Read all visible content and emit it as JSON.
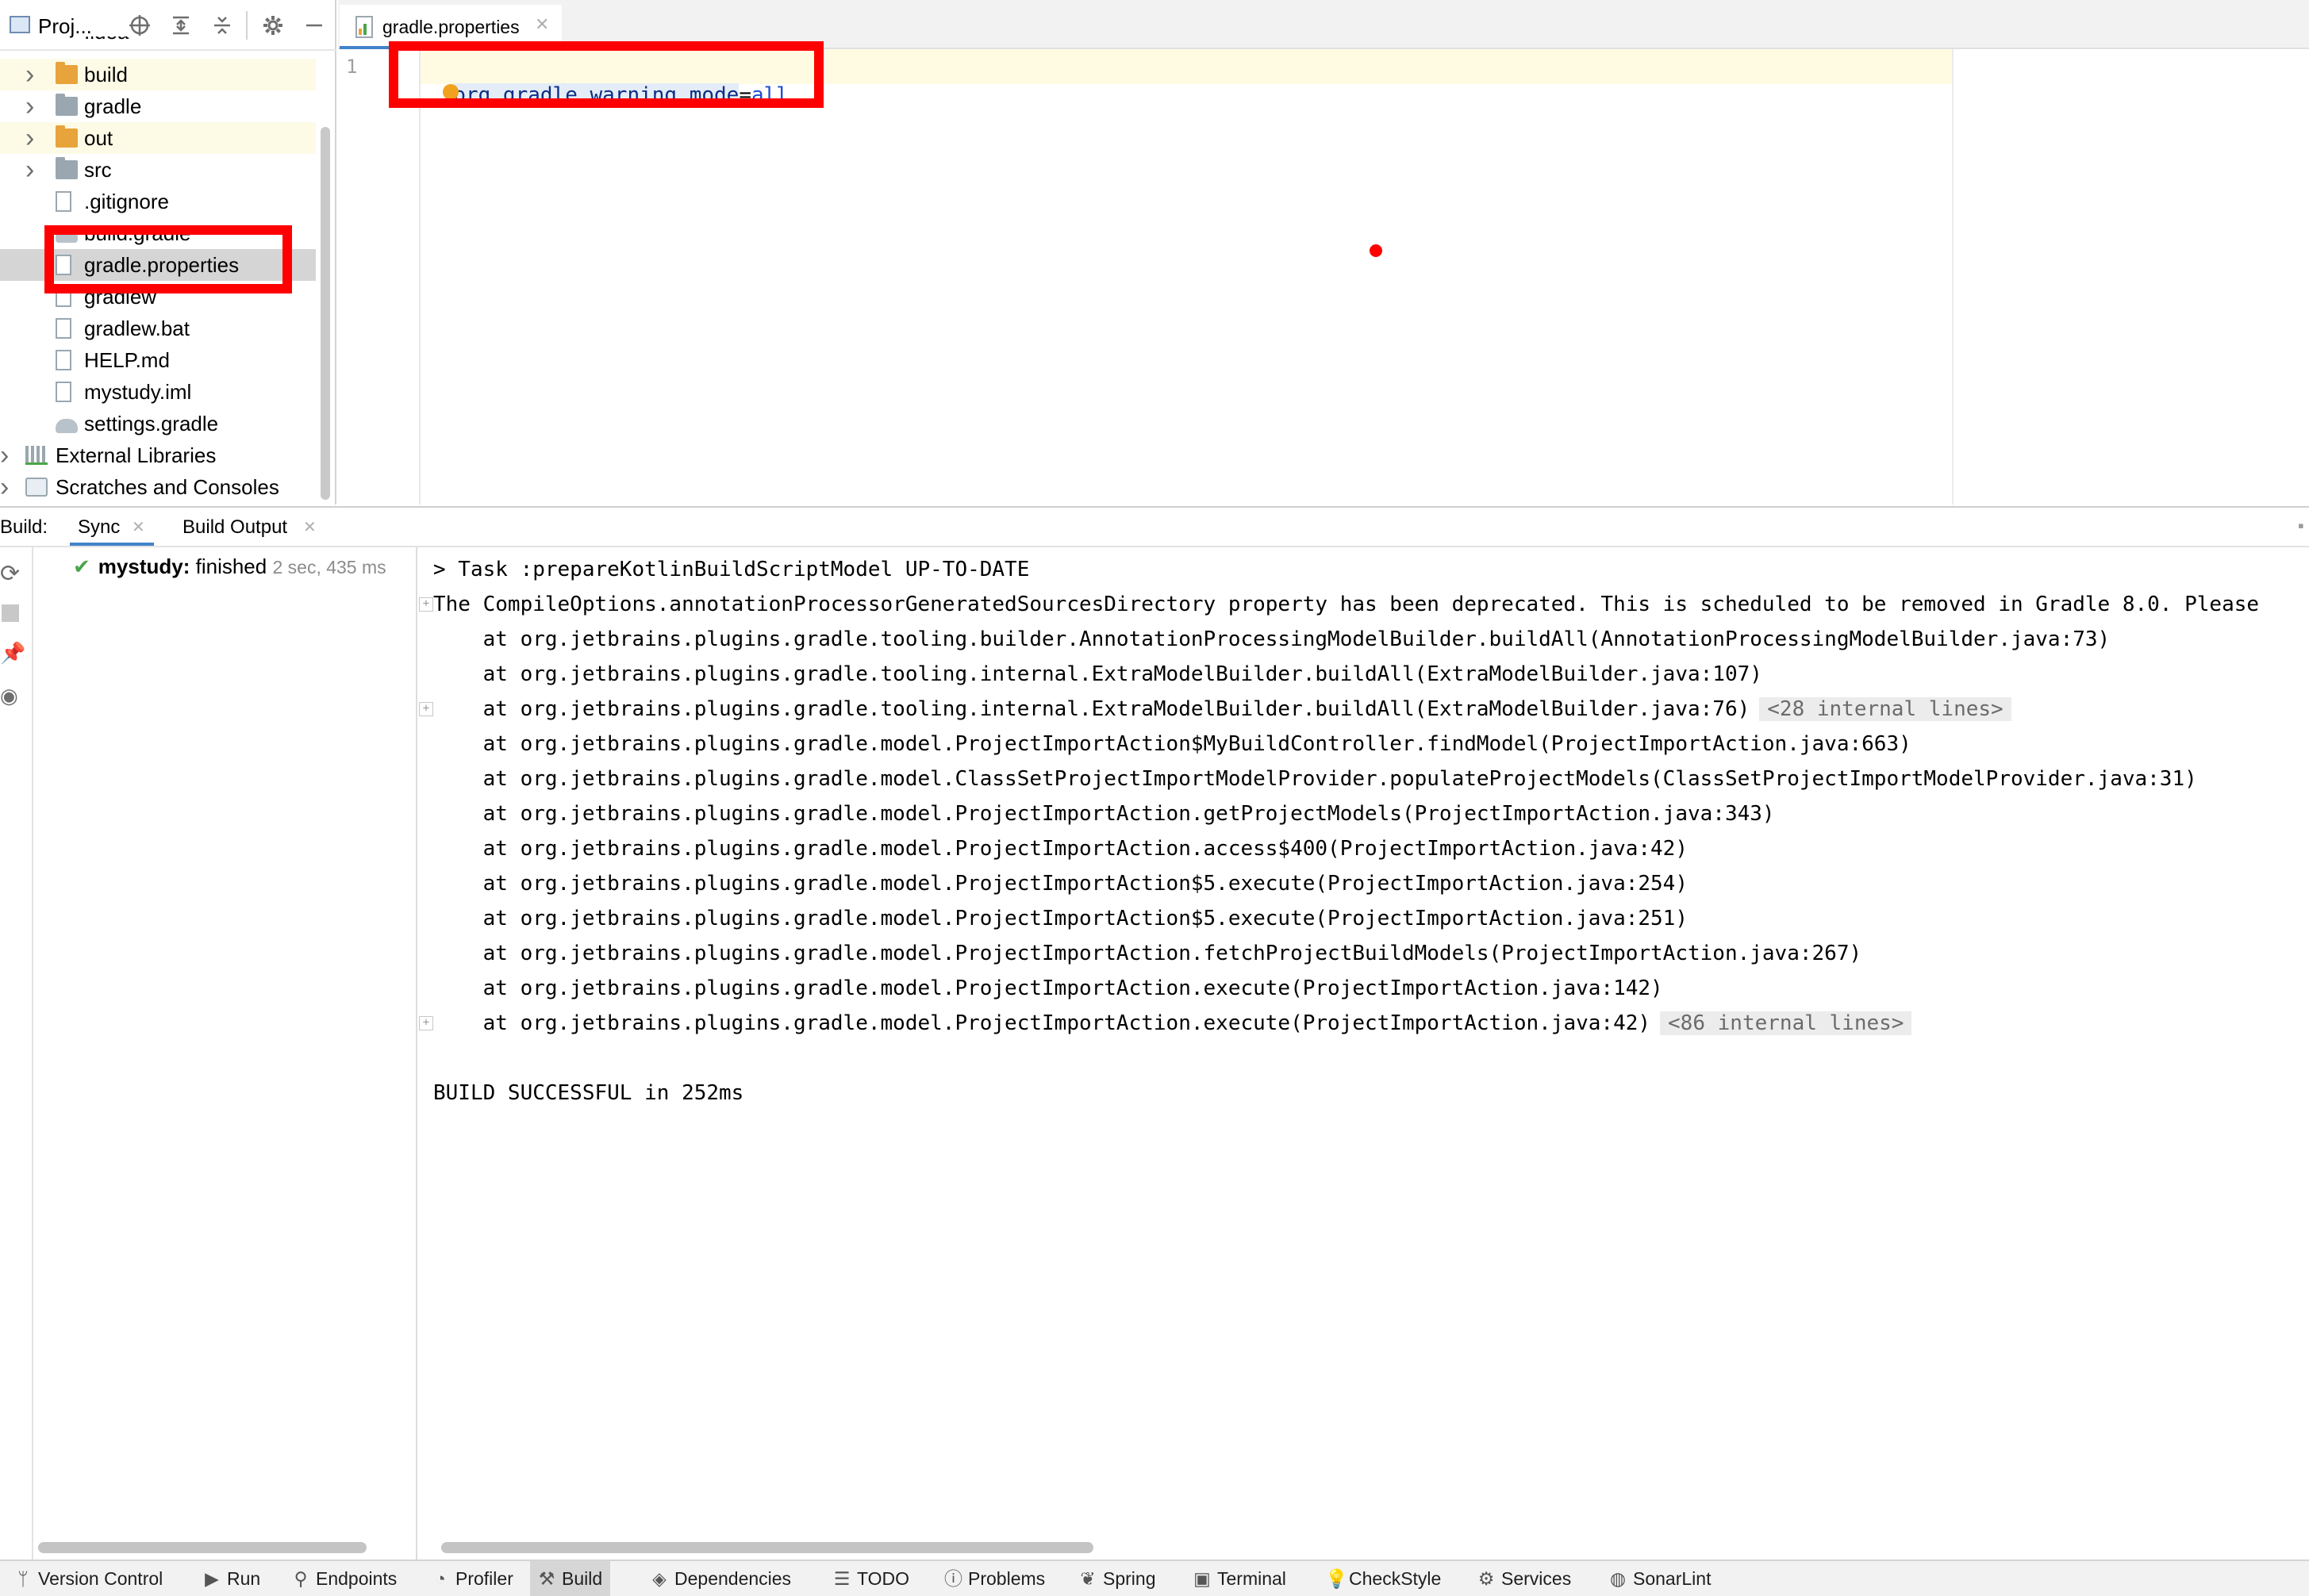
{
  "project_panel": {
    "title": "Proj...",
    "tree": [
      {
        "label": "build",
        "icon": "folder-orange-icon",
        "expandable": true,
        "highlight": true
      },
      {
        "label": "gradle",
        "icon": "folder-icon",
        "expandable": true,
        "highlight": false
      },
      {
        "label": "out",
        "icon": "folder-orange-icon",
        "expandable": true,
        "highlight": true
      },
      {
        "label": "src",
        "icon": "folder-icon",
        "expandable": true,
        "highlight": false
      },
      {
        "label": ".gitignore",
        "icon": "file-icon",
        "expandable": false
      },
      {
        "label": "build.gradle",
        "icon": "gradle-icon",
        "expandable": false
      },
      {
        "label": "gradle.properties",
        "icon": "properties-icon",
        "expandable": false,
        "selected": true
      },
      {
        "label": "gradlew",
        "icon": "file-icon",
        "expandable": false
      },
      {
        "label": "gradlew.bat",
        "icon": "file-icon",
        "expandable": false
      },
      {
        "label": "HELP.md",
        "icon": "markdown-icon",
        "expandable": false
      },
      {
        "label": "mystudy.iml",
        "icon": "iml-icon",
        "expandable": false
      },
      {
        "label": "settings.gradle",
        "icon": "gradle-icon",
        "expandable": false
      },
      {
        "label": "External Libraries",
        "icon": "libraries-icon",
        "expandable": true
      },
      {
        "label": "Scratches and Consoles",
        "icon": "scratches-icon",
        "expandable": true
      }
    ],
    "partial_top_label": ".idea"
  },
  "editor": {
    "tab_label": "gradle.properties",
    "line_number": "1",
    "code_key": "org.gradle.warning.mode",
    "code_eq": "=",
    "code_value": "all"
  },
  "build": {
    "title": "Build:",
    "tabs": [
      "Sync",
      "Build Output"
    ],
    "sync_item_name": "mystudy:",
    "sync_item_status": "finished",
    "sync_item_time": "2 sec, 435 ms",
    "console_lines": [
      "> Task :prepareKotlinBuildScriptModel UP-TO-DATE",
      "The CompileOptions.annotationProcessorGeneratedSourcesDirectory property has been deprecated. This is scheduled to be removed in Gradle 8.0. Please",
      "    at org.jetbrains.plugins.gradle.tooling.builder.AnnotationProcessingModelBuilder.buildAll(AnnotationProcessingModelBuilder.java:73)",
      "    at org.jetbrains.plugins.gradle.tooling.internal.ExtraModelBuilder.buildAll(ExtraModelBuilder.java:107)",
      "    at org.jetbrains.plugins.gradle.tooling.internal.ExtraModelBuilder.buildAll(ExtraModelBuilder.java:76)",
      "    at org.jetbrains.plugins.gradle.model.ProjectImportAction$MyBuildController.findModel(ProjectImportAction.java:663)",
      "    at org.jetbrains.plugins.gradle.model.ClassSetProjectImportModelProvider.populateProjectModels(ClassSetProjectImportModelProvider.java:31)",
      "    at org.jetbrains.plugins.gradle.model.ProjectImportAction.getProjectModels(ProjectImportAction.java:343)",
      "    at org.jetbrains.plugins.gradle.model.ProjectImportAction.access$400(ProjectImportAction.java:42)",
      "    at org.jetbrains.plugins.gradle.model.ProjectImportAction$5.execute(ProjectImportAction.java:254)",
      "    at org.jetbrains.plugins.gradle.model.ProjectImportAction$5.execute(ProjectImportAction.java:251)",
      "    at org.jetbrains.plugins.gradle.model.ProjectImportAction.fetchProjectBuildModels(ProjectImportAction.java:267)",
      "    at org.jetbrains.plugins.gradle.model.ProjectImportAction.execute(ProjectImportAction.java:142)",
      "    at org.jetbrains.plugins.gradle.model.ProjectImportAction.execute(ProjectImportAction.java:42)",
      "",
      "BUILD SUCCESSFUL in 252ms"
    ],
    "internal_lines_28": "<28 internal lines>",
    "internal_lines_86": "<86 internal lines>"
  },
  "bottom_bar": [
    {
      "label": "Version Control",
      "icon": "version-control-icon"
    },
    {
      "label": "Run",
      "icon": "run-icon"
    },
    {
      "label": "Endpoints",
      "icon": "endpoints-icon"
    },
    {
      "label": "Profiler",
      "icon": "profiler-icon"
    },
    {
      "label": "Build",
      "icon": "build-hammer-icon",
      "active": true
    },
    {
      "label": "Dependencies",
      "icon": "dependencies-icon"
    },
    {
      "label": "TODO",
      "icon": "todo-icon"
    },
    {
      "label": "Problems",
      "icon": "problems-icon"
    },
    {
      "label": "Spring",
      "icon": "spring-icon"
    },
    {
      "label": "Terminal",
      "icon": "terminal-icon"
    },
    {
      "label": "CheckStyle",
      "icon": "checkstyle-icon"
    },
    {
      "label": "Services",
      "icon": "services-icon"
    },
    {
      "label": "SonarLint",
      "icon": "sonarlint-icon"
    }
  ],
  "colors": {
    "annotation_red": "#ff0000",
    "selection_blue": "#4083c9",
    "success_green": "#4aa548",
    "folder_orange": "#e8a33b"
  }
}
